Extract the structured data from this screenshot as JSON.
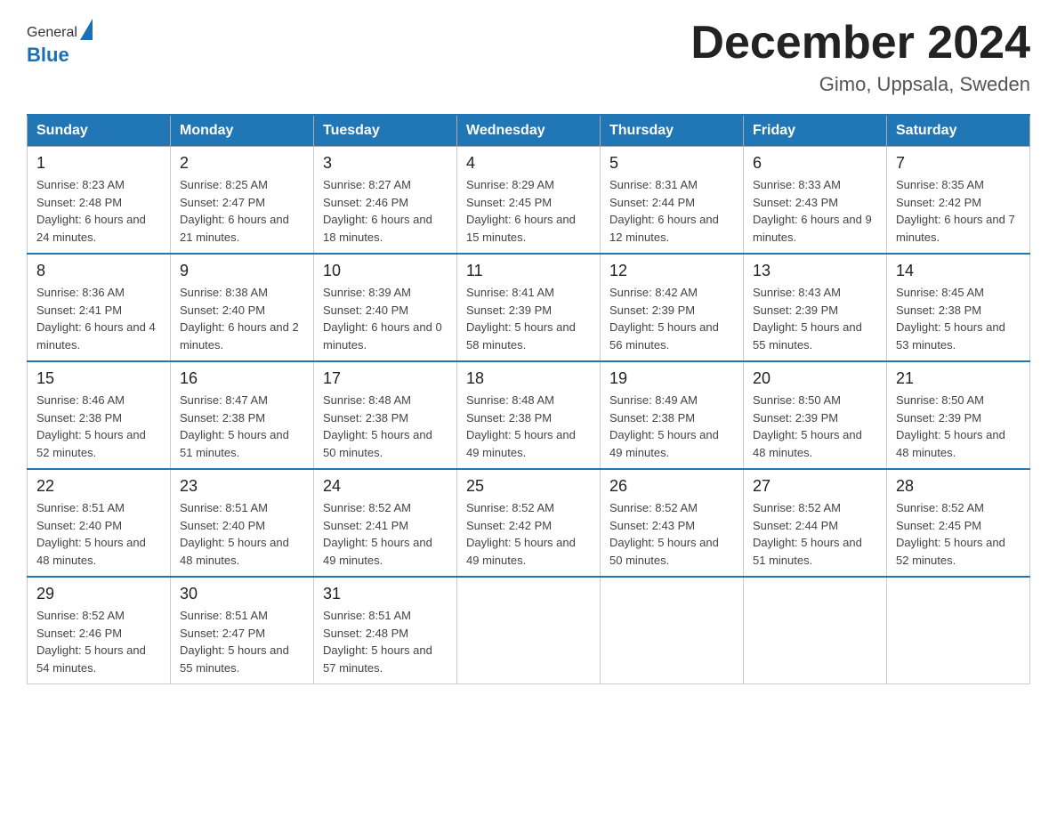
{
  "header": {
    "logo_general": "General",
    "logo_blue": "Blue",
    "title": "December 2024",
    "subtitle": "Gimo, Uppsala, Sweden"
  },
  "weekdays": [
    "Sunday",
    "Monday",
    "Tuesday",
    "Wednesday",
    "Thursday",
    "Friday",
    "Saturday"
  ],
  "weeks": [
    [
      {
        "day": "1",
        "sunrise": "8:23 AM",
        "sunset": "2:48 PM",
        "daylight": "6 hours and 24 minutes."
      },
      {
        "day": "2",
        "sunrise": "8:25 AM",
        "sunset": "2:47 PM",
        "daylight": "6 hours and 21 minutes."
      },
      {
        "day": "3",
        "sunrise": "8:27 AM",
        "sunset": "2:46 PM",
        "daylight": "6 hours and 18 minutes."
      },
      {
        "day": "4",
        "sunrise": "8:29 AM",
        "sunset": "2:45 PM",
        "daylight": "6 hours and 15 minutes."
      },
      {
        "day": "5",
        "sunrise": "8:31 AM",
        "sunset": "2:44 PM",
        "daylight": "6 hours and 12 minutes."
      },
      {
        "day": "6",
        "sunrise": "8:33 AM",
        "sunset": "2:43 PM",
        "daylight": "6 hours and 9 minutes."
      },
      {
        "day": "7",
        "sunrise": "8:35 AM",
        "sunset": "2:42 PM",
        "daylight": "6 hours and 7 minutes."
      }
    ],
    [
      {
        "day": "8",
        "sunrise": "8:36 AM",
        "sunset": "2:41 PM",
        "daylight": "6 hours and 4 minutes."
      },
      {
        "day": "9",
        "sunrise": "8:38 AM",
        "sunset": "2:40 PM",
        "daylight": "6 hours and 2 minutes."
      },
      {
        "day": "10",
        "sunrise": "8:39 AM",
        "sunset": "2:40 PM",
        "daylight": "6 hours and 0 minutes."
      },
      {
        "day": "11",
        "sunrise": "8:41 AM",
        "sunset": "2:39 PM",
        "daylight": "5 hours and 58 minutes."
      },
      {
        "day": "12",
        "sunrise": "8:42 AM",
        "sunset": "2:39 PM",
        "daylight": "5 hours and 56 minutes."
      },
      {
        "day": "13",
        "sunrise": "8:43 AM",
        "sunset": "2:39 PM",
        "daylight": "5 hours and 55 minutes."
      },
      {
        "day": "14",
        "sunrise": "8:45 AM",
        "sunset": "2:38 PM",
        "daylight": "5 hours and 53 minutes."
      }
    ],
    [
      {
        "day": "15",
        "sunrise": "8:46 AM",
        "sunset": "2:38 PM",
        "daylight": "5 hours and 52 minutes."
      },
      {
        "day": "16",
        "sunrise": "8:47 AM",
        "sunset": "2:38 PM",
        "daylight": "5 hours and 51 minutes."
      },
      {
        "day": "17",
        "sunrise": "8:48 AM",
        "sunset": "2:38 PM",
        "daylight": "5 hours and 50 minutes."
      },
      {
        "day": "18",
        "sunrise": "8:48 AM",
        "sunset": "2:38 PM",
        "daylight": "5 hours and 49 minutes."
      },
      {
        "day": "19",
        "sunrise": "8:49 AM",
        "sunset": "2:38 PM",
        "daylight": "5 hours and 49 minutes."
      },
      {
        "day": "20",
        "sunrise": "8:50 AM",
        "sunset": "2:39 PM",
        "daylight": "5 hours and 48 minutes."
      },
      {
        "day": "21",
        "sunrise": "8:50 AM",
        "sunset": "2:39 PM",
        "daylight": "5 hours and 48 minutes."
      }
    ],
    [
      {
        "day": "22",
        "sunrise": "8:51 AM",
        "sunset": "2:40 PM",
        "daylight": "5 hours and 48 minutes."
      },
      {
        "day": "23",
        "sunrise": "8:51 AM",
        "sunset": "2:40 PM",
        "daylight": "5 hours and 48 minutes."
      },
      {
        "day": "24",
        "sunrise": "8:52 AM",
        "sunset": "2:41 PM",
        "daylight": "5 hours and 49 minutes."
      },
      {
        "day": "25",
        "sunrise": "8:52 AM",
        "sunset": "2:42 PM",
        "daylight": "5 hours and 49 minutes."
      },
      {
        "day": "26",
        "sunrise": "8:52 AM",
        "sunset": "2:43 PM",
        "daylight": "5 hours and 50 minutes."
      },
      {
        "day": "27",
        "sunrise": "8:52 AM",
        "sunset": "2:44 PM",
        "daylight": "5 hours and 51 minutes."
      },
      {
        "day": "28",
        "sunrise": "8:52 AM",
        "sunset": "2:45 PM",
        "daylight": "5 hours and 52 minutes."
      }
    ],
    [
      {
        "day": "29",
        "sunrise": "8:52 AM",
        "sunset": "2:46 PM",
        "daylight": "5 hours and 54 minutes."
      },
      {
        "day": "30",
        "sunrise": "8:51 AM",
        "sunset": "2:47 PM",
        "daylight": "5 hours and 55 minutes."
      },
      {
        "day": "31",
        "sunrise": "8:51 AM",
        "sunset": "2:48 PM",
        "daylight": "5 hours and 57 minutes."
      },
      null,
      null,
      null,
      null
    ]
  ],
  "labels": {
    "sunrise": "Sunrise:",
    "sunset": "Sunset:",
    "daylight": "Daylight:"
  }
}
